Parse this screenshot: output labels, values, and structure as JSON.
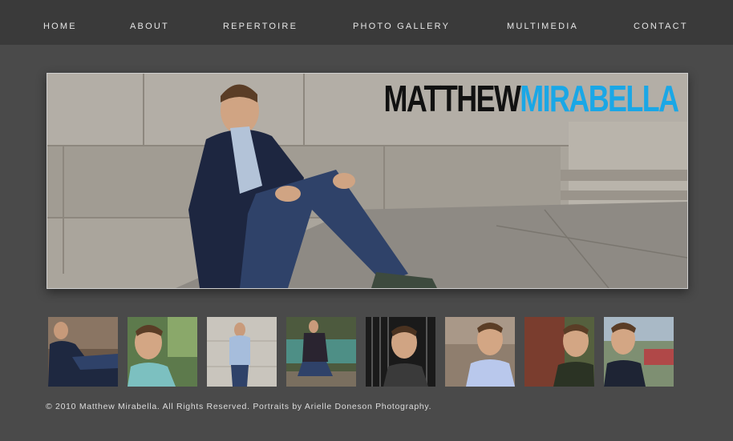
{
  "nav": {
    "items": [
      {
        "label": "HOME"
      },
      {
        "label": "ABOUT"
      },
      {
        "label": "REPERTOIRE"
      },
      {
        "label": "PHOTO GALLERY"
      },
      {
        "label": "MULTIMEDIA"
      },
      {
        "label": "CONTACT"
      }
    ]
  },
  "hero": {
    "first_name": "MATTHEW",
    "last_name": "MIRABELLA"
  },
  "gallery": {
    "thumbnails": [
      {
        "subject": "seated against wall"
      },
      {
        "subject": "outdoor portrait, teal shirt"
      },
      {
        "subject": "standing by stone wall"
      },
      {
        "subject": "seated by fountain"
      },
      {
        "subject": "by iron gate"
      },
      {
        "subject": "close-up, light blue shirt"
      },
      {
        "subject": "by brick wall"
      },
      {
        "subject": "park portrait"
      }
    ]
  },
  "footer": {
    "text": "© 2010 Matthew Mirabella. All Rights Reserved. Portraits by Arielle Doneson Photography."
  },
  "colors": {
    "background": "#4a4a4a",
    "nav_background": "#3a3a3a",
    "accent": "#1aa7e6"
  }
}
